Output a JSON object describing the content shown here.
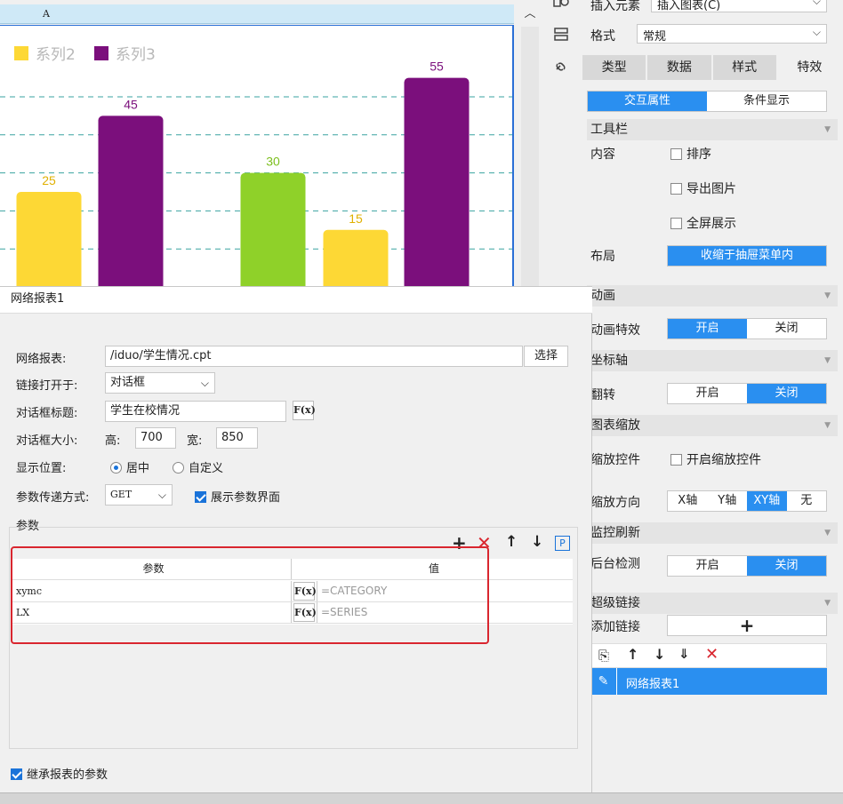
{
  "chart": {
    "column_header": "A",
    "legend": [
      {
        "name": "系列2",
        "color": "#fdd835"
      },
      {
        "name": "系列3",
        "color": "#7b0f7c"
      }
    ]
  },
  "chart_data": {
    "type": "bar",
    "legend_position": "top-left",
    "grid": true,
    "ylim": [
      0,
      60
    ],
    "series": [
      {
        "name": "",
        "color": "#8fd129",
        "values": [
          null,
          30
        ]
      },
      {
        "name": "系列2",
        "color": "#fdd835",
        "values": [
          25,
          15
        ]
      },
      {
        "name": "系列3",
        "color": "#7b0f7c",
        "values": [
          45,
          55
        ]
      }
    ],
    "bar_labels": [
      {
        "series": "系列2",
        "value": "25"
      },
      {
        "series": "系列3",
        "value": "45"
      },
      {
        "series": "",
        "value": "30"
      },
      {
        "series": "系列2",
        "value": "15"
      },
      {
        "series": "系列3",
        "value": "55"
      }
    ]
  },
  "right_panel": {
    "insert_label": "插入元素",
    "insert_value": "插入图表(C)",
    "format_label": "格式",
    "format_value": "常规",
    "tabs": [
      "类型",
      "数据",
      "样式",
      "特效"
    ],
    "subtabs": [
      "交互属性",
      "条件显示"
    ],
    "toolbar_section": "工具栏",
    "content_label": "内容",
    "checkbox_sort": "排序",
    "checkbox_export": "导出图片",
    "checkbox_fullscreen": "全屏展示",
    "layout_label": "布局",
    "layout_value": "收缩于抽屉菜单内",
    "animation_section": "动画",
    "animation_effect_label": "动画特效",
    "animation_on": "开启",
    "animation_off": "关闭",
    "axis_section": "坐标轴",
    "flip_label": "翻转",
    "flip_on": "开启",
    "flip_off": "关闭",
    "zoom_section": "图表缩放",
    "zoom_control_label": "缩放控件",
    "zoom_control_checkbox": "开启缩放控件",
    "zoom_dir_label": "缩放方向",
    "zoom_dirs": [
      "X轴",
      "Y轴",
      "XY轴",
      "无"
    ],
    "monitor_section": "监控刷新",
    "backend_label": "后台检测",
    "backend_on": "开启",
    "backend_off": "关闭",
    "hyperlink_section": "超级链接",
    "add_link_label": "添加链接",
    "add_link_button": "+",
    "link_item": "网络报表1"
  },
  "dialog": {
    "title": "网络报表1",
    "report_label": "网络报表:",
    "report_value": "/iduo/学生情况.cpt",
    "choose_button": "选择",
    "open_in_label": "链接打开于:",
    "open_in_value": "对话框",
    "dlg_title_label": "对话框标题:",
    "dlg_title_value": "学生在校情况",
    "dlg_size_label": "对话框大小:",
    "height_label": "高:",
    "height_value": "700",
    "width_label": "宽:",
    "width_value": "850",
    "position_label": "显示位置:",
    "position_center": "居中",
    "position_custom": "自定义",
    "param_mode_label": "参数传递方式:",
    "param_mode_value": "GET",
    "show_param_ui": "展示参数界面",
    "params_section": "参数",
    "table_headers": [
      "参数",
      "值"
    ],
    "rows": [
      {
        "param": "xymc",
        "value": "=CATEGORY"
      },
      {
        "param": "LX",
        "value": "=SERIES"
      }
    ],
    "fx_label": "F(x)",
    "inherit_params": "继承报表的参数",
    "p_button": "P"
  }
}
